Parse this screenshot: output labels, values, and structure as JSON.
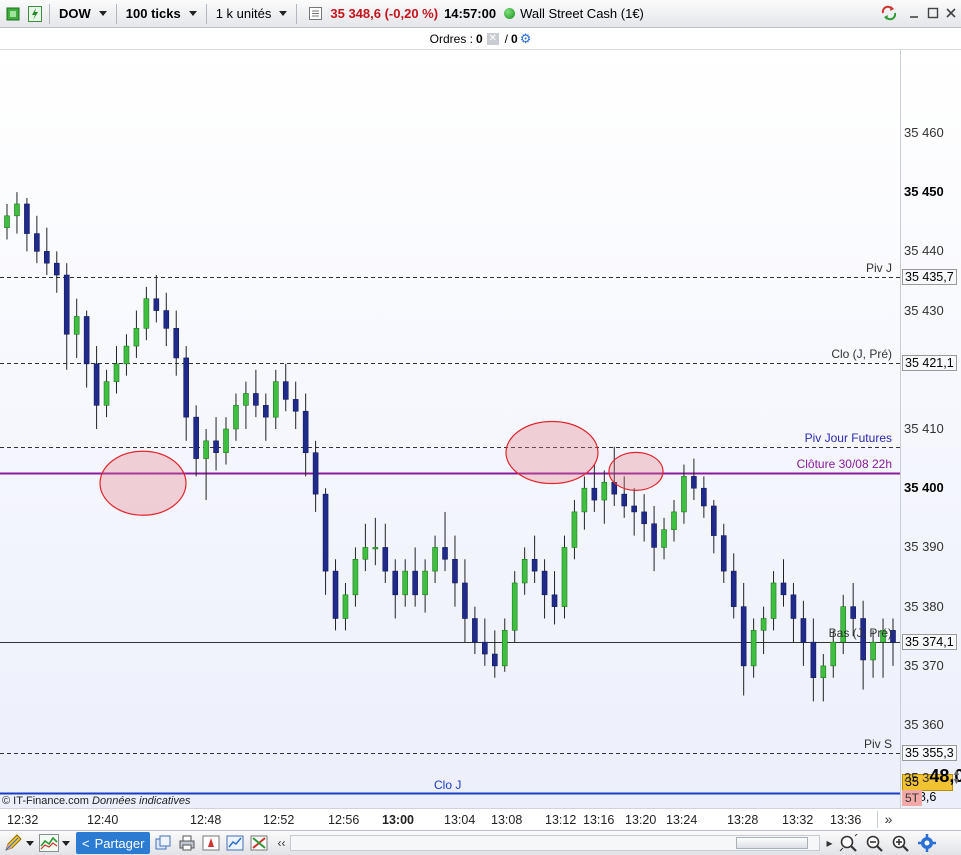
{
  "toolbar": {
    "symbol": "DOW",
    "ticks": "100 ticks",
    "units": "1 k unités",
    "price_change": "35 348,6 (-0,20 %)",
    "time": "14:57:00",
    "instrument": "Wall Street Cash (1€)",
    "icons": [
      "green-square-icon",
      "green-lightning-icon",
      "chart-settings-icon",
      "refresh-icon",
      "minimize-icon",
      "maximize-icon",
      "close-icon"
    ]
  },
  "orders": {
    "label": "Ordres :",
    "count1": "0",
    "count2": "0"
  },
  "axis": {
    "price_labels": [
      {
        "text": "35 460",
        "bold": false
      },
      {
        "text": "35 450",
        "bold": true
      },
      {
        "text": "35 440",
        "bold": false
      },
      {
        "text": "35 430",
        "bold": false
      },
      {
        "text": "35 410",
        "bold": false
      },
      {
        "text": "35 400",
        "bold": true
      },
      {
        "text": "35 390",
        "bold": false
      },
      {
        "text": "35 380",
        "bold": false
      },
      {
        "text": "35 370",
        "bold": false
      },
      {
        "text": "35 360",
        "bold": false
      }
    ],
    "current_prefix": "35 3",
    "current_big": "48,0",
    "timer": "5T",
    "last_price": "35 348,6"
  },
  "levels": [
    {
      "name": "Piv J",
      "value": "35 435,7",
      "color": "#333333"
    },
    {
      "name": "Clo (J, Pré)",
      "value": "35 421,1",
      "color": "#333333"
    },
    {
      "name": "Piv Jour Futures",
      "value": "",
      "color": "#2a2ab0"
    },
    {
      "name": "Clôture 30/08 22h",
      "value": "",
      "color": "#8b1a9e"
    },
    {
      "name": "Bas (J, Pré)",
      "value": "35 374,1",
      "color": "#333333"
    },
    {
      "name": "Piv S",
      "value": "35 355,3",
      "color": "#333333"
    },
    {
      "name": "Clo J",
      "value": "",
      "color": "#1a3cc8"
    }
  ],
  "copyright": {
    "brand": "© IT-Finance.com",
    "note": "Données indicatives"
  },
  "time_axis": [
    "12:32",
    "12:40",
    "12:48",
    "12:52",
    "12:56",
    "13:00",
    "13:04",
    "13:08",
    "13:12",
    "13:16",
    "13:20",
    "13:24",
    "13:28",
    "13:32",
    "13:36"
  ],
  "bottom": {
    "share": "Partager"
  },
  "chart_data": {
    "type": "candlestick",
    "instrument": "Wall Street Cash (1€)",
    "interval": "100 ticks",
    "x_labels": [
      "12:32",
      "12:40",
      "12:48",
      "12:52",
      "12:56",
      "13:00",
      "13:04",
      "13:08",
      "13:12",
      "13:16",
      "13:20",
      "13:24",
      "13:28",
      "13:32",
      "13:36"
    ],
    "ylim": [
      35346,
      35474
    ],
    "y_ticks": [
      35360,
      35370,
      35380,
      35390,
      35400,
      35410,
      35420,
      35430,
      35440,
      35450,
      35460
    ],
    "reference_lines": [
      {
        "label": "Piv J",
        "value": 35435.7,
        "color": "#333333",
        "style": "dashed"
      },
      {
        "label": "Clo (J, Pré)",
        "value": 35421.1,
        "color": "#333333",
        "style": "dashed"
      },
      {
        "label": "Piv Jour Futures",
        "value": 35407,
        "color": "#333333",
        "style": "dashed"
      },
      {
        "label": "Clôture 30/08 22h",
        "value": 35402.5,
        "color": "#8b1a9e",
        "style": "solid"
      },
      {
        "label": "Bas (J, Pré)",
        "value": 35374.1,
        "color": "#333333",
        "style": "solid"
      },
      {
        "label": "Piv S",
        "value": 35355.3,
        "color": "#333333",
        "style": "dashed"
      },
      {
        "label": "Clo J",
        "value": 35348.6,
        "color": "#1a3cc8",
        "style": "solid"
      }
    ],
    "annotations": [
      {
        "type": "ellipse",
        "center_value": 35400,
        "note": "low near Clôture"
      },
      {
        "type": "ellipse",
        "center_value": 35404,
        "note": "high near Piv Jour Futures"
      },
      {
        "type": "ellipse",
        "center_value": 35402,
        "note": "retest"
      }
    ],
    "candles": [
      [
        35444,
        35448,
        35442,
        35446
      ],
      [
        35446,
        35450,
        35443,
        35448
      ],
      [
        35448,
        35449,
        35440,
        35443
      ],
      [
        35443,
        35446,
        35438,
        35440
      ],
      [
        35440,
        35444,
        35436,
        35438
      ],
      [
        35438,
        35440,
        35433,
        35436
      ],
      [
        35436,
        35438,
        35420,
        35426
      ],
      [
        35426,
        35432,
        35422,
        35429
      ],
      [
        35429,
        35430,
        35417,
        35421
      ],
      [
        35421,
        35424,
        35410,
        35414
      ],
      [
        35414,
        35420,
        35412,
        35418
      ],
      [
        35418,
        35424,
        35416,
        35421
      ],
      [
        35421,
        35426,
        35419,
        35424
      ],
      [
        35424,
        35430,
        35422,
        35427
      ],
      [
        35427,
        35434,
        35425,
        35432
      ],
      [
        35432,
        35436,
        35428,
        35430
      ],
      [
        35430,
        35433,
        35424,
        35427
      ],
      [
        35427,
        35430,
        35419,
        35422
      ],
      [
        35422,
        35424,
        35408,
        35412
      ],
      [
        35412,
        35414,
        35402,
        35405
      ],
      [
        35405,
        35410,
        35398,
        35408
      ],
      [
        35408,
        35412,
        35403,
        35406
      ],
      [
        35406,
        35412,
        35404,
        35410
      ],
      [
        35410,
        35416,
        35408,
        35414
      ],
      [
        35414,
        35418,
        35410,
        35416
      ],
      [
        35416,
        35420,
        35412,
        35414
      ],
      [
        35414,
        35416,
        35408,
        35412
      ],
      [
        35412,
        35420,
        35410,
        35418
      ],
      [
        35418,
        35421,
        35413,
        35415
      ],
      [
        35415,
        35418,
        35410,
        35413
      ],
      [
        35413,
        35416,
        35402,
        35406
      ],
      [
        35406,
        35408,
        35396,
        35399
      ],
      [
        35399,
        35400,
        35382,
        35386
      ],
      [
        35386,
        35388,
        35376,
        35378
      ],
      [
        35378,
        35384,
        35376,
        35382
      ],
      [
        35382,
        35390,
        35380,
        35388
      ],
      [
        35388,
        35394,
        35386,
        35390
      ],
      [
        35390,
        35395,
        35387,
        35390
      ],
      [
        35390,
        35394,
        35384,
        35386
      ],
      [
        35386,
        35388,
        35378,
        35382
      ],
      [
        35382,
        35388,
        35380,
        35386
      ],
      [
        35386,
        35390,
        35380,
        35382
      ],
      [
        35382,
        35388,
        35379,
        35386
      ],
      [
        35386,
        35392,
        35384,
        35390
      ],
      [
        35390,
        35396,
        35386,
        35388
      ],
      [
        35388,
        35392,
        35380,
        35384
      ],
      [
        35384,
        35388,
        35374,
        35378
      ],
      [
        35378,
        35380,
        35372,
        35374
      ],
      [
        35374,
        35378,
        35370,
        35372
      ],
      [
        35372,
        35376,
        35368,
        35370
      ],
      [
        35370,
        35378,
        35369,
        35376
      ],
      [
        35376,
        35386,
        35374,
        35384
      ],
      [
        35384,
        35390,
        35382,
        35388
      ],
      [
        35388,
        35392,
        35384,
        35386
      ],
      [
        35386,
        35388,
        35378,
        35382
      ],
      [
        35382,
        35386,
        35377,
        35380
      ],
      [
        35380,
        35392,
        35378,
        35390
      ],
      [
        35390,
        35398,
        35388,
        35396
      ],
      [
        35396,
        35402,
        35393,
        35400
      ],
      [
        35400,
        35404,
        35396,
        35398
      ],
      [
        35398,
        35403,
        35394,
        35401
      ],
      [
        35401,
        35407,
        35397,
        35399
      ],
      [
        35399,
        35402,
        35395,
        35397
      ],
      [
        35397,
        35400,
        35392,
        35396
      ],
      [
        35396,
        35399,
        35391,
        35394
      ],
      [
        35394,
        35397,
        35386,
        35390
      ],
      [
        35390,
        35395,
        35388,
        35393
      ],
      [
        35393,
        35398,
        35391,
        35396
      ],
      [
        35396,
        35404,
        35394,
        35402
      ],
      [
        35402,
        35405,
        35398,
        35400
      ],
      [
        35400,
        35402,
        35395,
        35397
      ],
      [
        35397,
        35398,
        35389,
        35392
      ],
      [
        35392,
        35394,
        35384,
        35386
      ],
      [
        35386,
        35389,
        35378,
        35380
      ],
      [
        35380,
        35384,
        35365,
        35370
      ],
      [
        35370,
        35378,
        35368,
        35376
      ],
      [
        35376,
        35380,
        35372,
        35378
      ],
      [
        35378,
        35386,
        35376,
        35384
      ],
      [
        35384,
        35388,
        35380,
        35382
      ],
      [
        35382,
        35384,
        35374,
        35378
      ],
      [
        35378,
        35381,
        35370,
        35374
      ],
      [
        35374,
        35378,
        35364,
        35368
      ],
      [
        35368,
        35372,
        35364,
        35370
      ],
      [
        35370,
        35376,
        35368,
        35374
      ],
      [
        35374,
        35382,
        35372,
        35380
      ],
      [
        35380,
        35384,
        35375,
        35378
      ],
      [
        35378,
        35381,
        35366,
        35371
      ],
      [
        35371,
        35376,
        35368,
        35374
      ],
      [
        35374,
        35378,
        35368,
        35376
      ],
      [
        35376,
        35378,
        35370,
        35374
      ]
    ]
  }
}
